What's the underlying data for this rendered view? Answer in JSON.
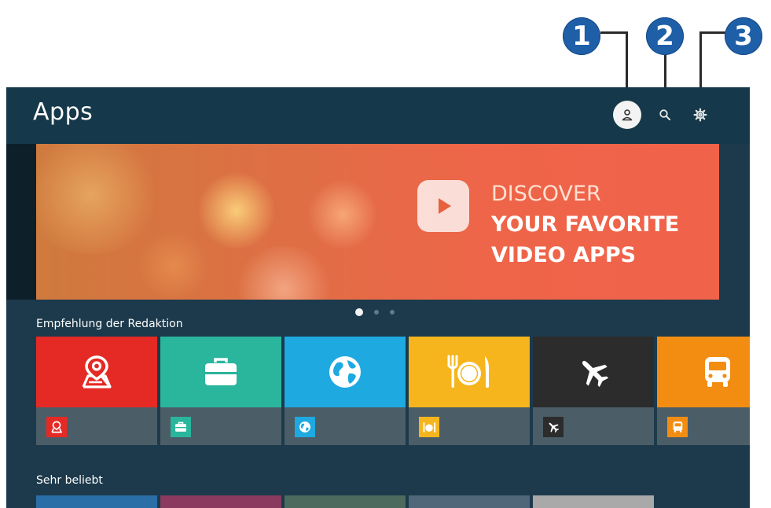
{
  "callouts": [
    "1",
    "2",
    "3"
  ],
  "header": {
    "title": "Apps",
    "icons": [
      "account-icon",
      "search-icon",
      "settings-gear-icon"
    ]
  },
  "banner": {
    "line1": "DISCOVER",
    "line2": "YOUR FAVORITE",
    "line3": "VIDEO APPS",
    "icon": "play-icon",
    "pages": 3,
    "active_page": 1
  },
  "sections": {
    "editors_pick": "Empfehlung der Redaktion",
    "popular": "Sehr beliebt"
  },
  "editors_apps": [
    {
      "icon": "map-pin-icon",
      "color": "#e52a25"
    },
    {
      "icon": "briefcase-icon",
      "color": "#2ab59d"
    },
    {
      "icon": "globe-icon",
      "color": "#1ea9e1"
    },
    {
      "icon": "dining-icon",
      "color": "#f6b51c"
    },
    {
      "icon": "airplane-icon",
      "color": "#2c2c2c"
    },
    {
      "icon": "bus-icon",
      "color": "#f38d12"
    }
  ],
  "popular_colors": [
    "#2a6ea8",
    "#8a3a5e",
    "#4d6a5e",
    "#4f6779",
    "#a9a9a9",
    "#1c3a4c"
  ]
}
